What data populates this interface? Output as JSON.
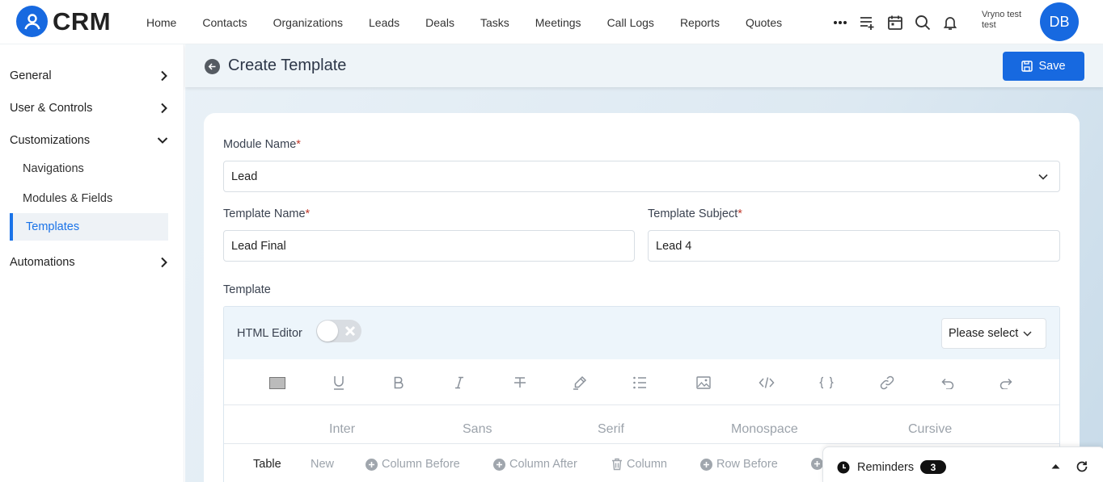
{
  "app": {
    "logo_text": "CRM"
  },
  "nav": {
    "items": [
      "Home",
      "Contacts",
      "Organizations",
      "Leads",
      "Deals",
      "Tasks",
      "Meetings",
      "Call Logs",
      "Reports",
      "Quotes"
    ],
    "icons": [
      "more-icon",
      "add-list-icon",
      "calendar-icon",
      "search-icon",
      "bell-icon"
    ]
  },
  "user": {
    "name_line1": "Vryno test",
    "name_line2": "test",
    "initials": "DB"
  },
  "sidebar": {
    "sections": [
      {
        "label": "General",
        "state": "collapsed"
      },
      {
        "label": "User & Controls",
        "state": "collapsed"
      },
      {
        "label": "Customizations",
        "state": "expanded"
      },
      {
        "label": "Automations",
        "state": "collapsed"
      }
    ],
    "sub_items": [
      "Navigations",
      "Modules & Fields",
      "Templates"
    ],
    "active_sub_item": "Templates"
  },
  "header": {
    "title": "Create Template",
    "save_label": "Save"
  },
  "form": {
    "module_name": {
      "label": "Module Name",
      "required_mark": "*",
      "value": "Lead"
    },
    "template_name": {
      "label": "Template Name",
      "required_mark": "*",
      "value": "Lead Final"
    },
    "template_subject": {
      "label": "Template Subject",
      "required_mark": "*",
      "value": "Lead 4"
    },
    "template_label": "Template"
  },
  "editor": {
    "html_editor_label": "HTML Editor",
    "html_editor_enabled": false,
    "select_placeholder": "Please select",
    "toolbar_icons": [
      "color-swatch-icon",
      "underline-icon",
      "bold-icon",
      "italic-icon",
      "strikethrough-icon",
      "highlight-icon",
      "list-icon",
      "image-icon",
      "code-icon",
      "braces-icon",
      "link-icon",
      "undo-icon",
      "redo-icon"
    ],
    "fonts": [
      "Inter",
      "Sans",
      "Serif",
      "Monospace",
      "Cursive"
    ],
    "table_tools": {
      "table": "Table",
      "new": "New",
      "column_before": "Column Before",
      "column_after": "Column After",
      "column": "Column",
      "row_before": "Row Before"
    }
  },
  "reminders": {
    "label": "Reminders",
    "count": "3"
  },
  "colors": {
    "accent": "#1769e0",
    "active_text": "#1a73e8",
    "required": "#c0392b"
  }
}
